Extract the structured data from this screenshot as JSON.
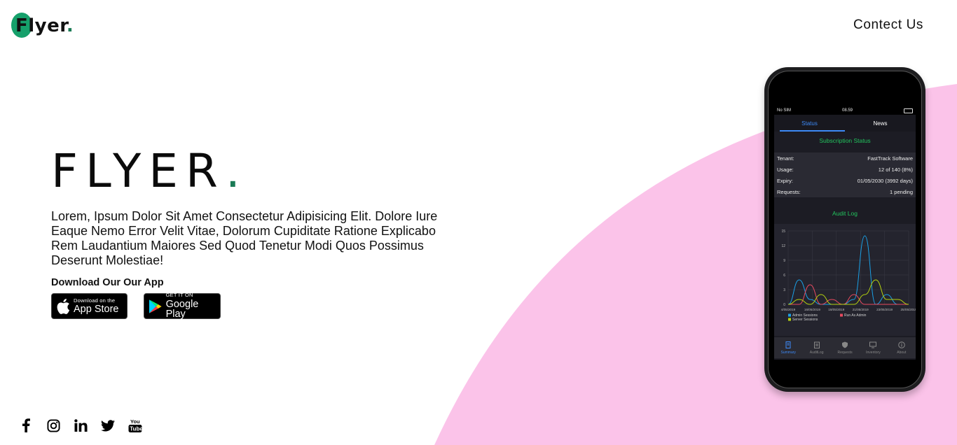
{
  "brand": {
    "logo_letter": "F",
    "logo_rest": "lyer",
    "logo_dot": ".",
    "accent": "#16a06b",
    "pink": "#fbc3e9"
  },
  "nav": {
    "contact": "Contect Us"
  },
  "hero": {
    "title": "FLYER",
    "title_dot": ".",
    "description": "Lorem, Ipsum Dolor Sit Amet Consectetur Adipisicing Elit. Dolore Iure Eaque Nemo Error Velit Vitae, Dolorum Cupiditate Ratione Explicabo Rem Laudantium Maiores Sed Quod Tenetur Modi Quos Possimus Deserunt Molestiae!",
    "download_label": "Download Our Our App",
    "appstore_small": "Download on the",
    "appstore_big": "App Store",
    "googleplay_small": "GET IT ON",
    "googleplay_big": "Google Play"
  },
  "social": [
    "facebook-icon",
    "instagram-icon",
    "linkedin-icon",
    "twitter-icon",
    "youtube-icon"
  ],
  "phone": {
    "carrier": "No SIM",
    "time": "08.59",
    "tabs": [
      "Status",
      "News"
    ],
    "subscription_title": "Subscription Status",
    "rows": [
      {
        "label": "Tenant:",
        "value": "FastTrack Software"
      },
      {
        "label": "Usage:",
        "value": "12 of 140 (8%)"
      },
      {
        "label": "Expiry:",
        "value": "01/05/2030 (3992 days)"
      },
      {
        "label": "Requests:",
        "value": "1 pending"
      }
    ],
    "audit_title": "Audit Log",
    "bottom_nav": [
      "Summary",
      "AuditLog",
      "Requests",
      "Inventory",
      "About"
    ],
    "chart_data": {
      "type": "line",
      "x": [
        "4/05/2019",
        "16/05/2019",
        "18/05/2019",
        "21/05/2019",
        "23/05/2019",
        "25/05/2019"
      ],
      "ylim": [
        0,
        15
      ],
      "yticks": [
        0,
        3,
        6,
        9,
        12,
        15
      ],
      "series": [
        {
          "name": "Admin Sessions",
          "color": "#1aa0e6",
          "values": [
            0,
            5,
            1,
            0,
            0,
            0,
            1,
            14,
            0,
            2,
            0,
            0
          ]
        },
        {
          "name": "Run As Admin",
          "color": "#e84a5f",
          "values": [
            0,
            0,
            4,
            0,
            1,
            0,
            2,
            0,
            0,
            0,
            0,
            0
          ]
        },
        {
          "name": "Server Sessions",
          "color": "#b5d20f",
          "values": [
            0,
            1,
            0,
            2,
            0,
            0,
            0,
            2,
            5,
            1,
            1,
            0
          ]
        }
      ]
    }
  }
}
